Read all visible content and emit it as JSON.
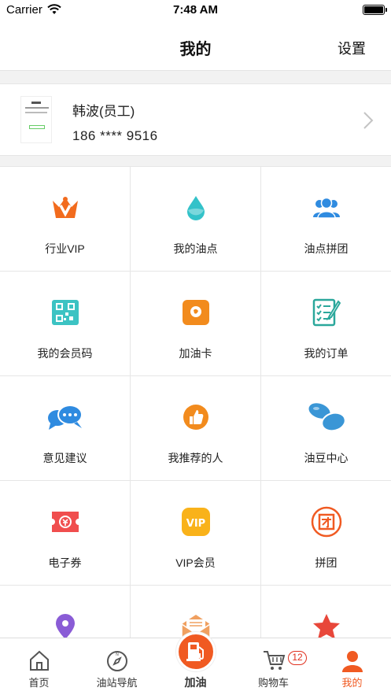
{
  "status_bar": {
    "carrier": "Carrier",
    "time": "7:48 AM"
  },
  "nav": {
    "title": "我的",
    "settings_label": "设置"
  },
  "profile": {
    "name": "韩波(员工)",
    "phone": "186 **** 9516"
  },
  "grid": {
    "items": [
      {
        "label": "行业VIP",
        "icon": "crown-v-icon",
        "color": "#f26b1d"
      },
      {
        "label": "我的油点",
        "icon": "droplet-icon",
        "color": "#33c2c9"
      },
      {
        "label": "油点拼团",
        "icon": "users-icon",
        "color": "#2f8be0"
      },
      {
        "label": "我的会员码",
        "icon": "qrcode-icon",
        "color": "#3cc3c3"
      },
      {
        "label": "加油卡",
        "icon": "fuel-card-icon",
        "color": "#f28b1d"
      },
      {
        "label": "我的订单",
        "icon": "order-list-icon",
        "color": "#2aa79b"
      },
      {
        "label": "意见建议",
        "icon": "chat-bubbles-icon",
        "color": "#2f8be0"
      },
      {
        "label": "我推荐的人",
        "icon": "thumbs-up-icon",
        "color": "#f28b1d"
      },
      {
        "label": "油豆中心",
        "icon": "beans-icon",
        "color": "#3a96d6"
      },
      {
        "label": "电子券",
        "icon": "coupon-icon",
        "color": "#f04e4e"
      },
      {
        "label": "VIP会员",
        "icon": "vip-badge-icon",
        "color": "#f9b21a"
      },
      {
        "label": "拼团",
        "icon": "group-stamp-icon",
        "color": "#f05a22"
      },
      {
        "label": "",
        "icon": "location-pin-icon",
        "color": "#8a5cd6"
      },
      {
        "label": "",
        "icon": "envelope-icon",
        "color": "#f0a060"
      },
      {
        "label": "",
        "icon": "star-icon",
        "color": "#e8473a"
      }
    ]
  },
  "tabs": {
    "home": "首页",
    "nav": "油站导航",
    "fuel": "加油",
    "cart": "购物车",
    "cart_count": "12",
    "mine": "我的"
  },
  "colors": {
    "accent": "#f05a22"
  }
}
